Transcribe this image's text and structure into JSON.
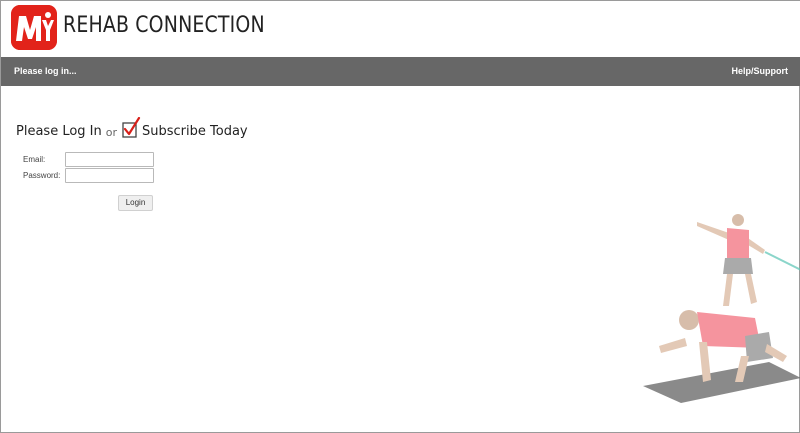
{
  "header": {
    "logo_letters": "MY",
    "brand_name": "REHAB CONNECTION"
  },
  "navbar": {
    "status_text": "Please log in...",
    "help_link": "Help/Support"
  },
  "login": {
    "heading": "Please Log In",
    "or_text": "or",
    "subscribe_text": "Subscribe Today",
    "email_label": "Email:",
    "email_value": "",
    "password_label": "Password:",
    "password_value": "",
    "login_button": "Login"
  },
  "colors": {
    "brand_red": "#e2231a",
    "navbar_gray": "#676767",
    "shirt_pink": "#f26b7a"
  },
  "icons": {
    "logo": "my-logo-icon",
    "subscribe": "checkbox-check-icon"
  }
}
